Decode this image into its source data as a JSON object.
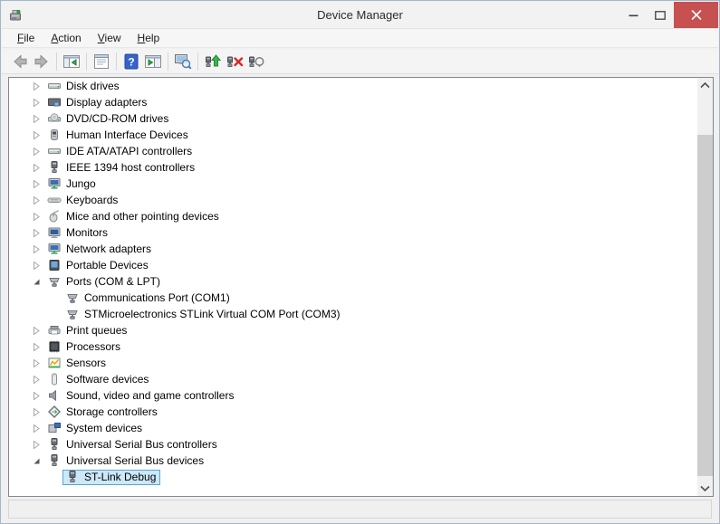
{
  "window": {
    "title": "Device Manager",
    "icon": "device-manager-icon",
    "controls": [
      {
        "name": "minimize-button",
        "icon": "minimize-icon"
      },
      {
        "name": "maximize-button",
        "icon": "maximize-icon"
      },
      {
        "name": "close-button",
        "icon": "close-icon"
      }
    ]
  },
  "menu": {
    "items": [
      {
        "first": "F",
        "rest": "ile"
      },
      {
        "first": "A",
        "rest": "ction"
      },
      {
        "first": "V",
        "rest": "iew"
      },
      {
        "first": "H",
        "rest": "elp"
      }
    ]
  },
  "toolbar": {
    "help_glyph": "?",
    "buttons": [
      "back",
      "forward",
      "show-hide-console-tree",
      "properties",
      "help",
      "show-hide-action-pane",
      "scan-computer",
      "update-driver",
      "uninstall-device",
      "scan-for-hardware-changes"
    ]
  },
  "tree": {
    "items": [
      {
        "label": "Disk drives",
        "icon": "disk",
        "level": 0,
        "state": "collapsed",
        "selected": false
      },
      {
        "label": "Display adapters",
        "icon": "display",
        "level": 0,
        "state": "collapsed",
        "selected": false
      },
      {
        "label": "DVD/CD-ROM drives",
        "icon": "dvd",
        "level": 0,
        "state": "collapsed",
        "selected": false
      },
      {
        "label": "Human Interface Devices",
        "icon": "hid",
        "level": 0,
        "state": "collapsed",
        "selected": false
      },
      {
        "label": "IDE ATA/ATAPI controllers",
        "icon": "disk",
        "level": 0,
        "state": "collapsed",
        "selected": false
      },
      {
        "label": "IEEE 1394 host controllers",
        "icon": "usb",
        "level": 0,
        "state": "collapsed",
        "selected": false
      },
      {
        "label": "Jungo",
        "icon": "netpc",
        "level": 0,
        "state": "collapsed",
        "selected": false
      },
      {
        "label": "Keyboards",
        "icon": "keyboard",
        "level": 0,
        "state": "collapsed",
        "selected": false
      },
      {
        "label": "Mice and other pointing devices",
        "icon": "mouse",
        "level": 0,
        "state": "collapsed",
        "selected": false
      },
      {
        "label": "Monitors",
        "icon": "monitor",
        "level": 0,
        "state": "collapsed",
        "selected": false
      },
      {
        "label": "Network adapters",
        "icon": "netpc",
        "level": 0,
        "state": "collapsed",
        "selected": false
      },
      {
        "label": "Portable Devices",
        "icon": "portable",
        "level": 0,
        "state": "collapsed",
        "selected": false
      },
      {
        "label": "Ports (COM & LPT)",
        "icon": "port",
        "level": 0,
        "state": "expanded",
        "selected": false
      },
      {
        "label": "Communications Port (COM1)",
        "icon": "port",
        "level": 1,
        "state": "leaf",
        "selected": false
      },
      {
        "label": "STMicroelectronics STLink Virtual COM Port (COM3)",
        "icon": "port",
        "level": 1,
        "state": "leaf",
        "selected": false
      },
      {
        "label": "Print queues",
        "icon": "printer",
        "level": 0,
        "state": "collapsed",
        "selected": false
      },
      {
        "label": "Processors",
        "icon": "cpu",
        "level": 0,
        "state": "collapsed",
        "selected": false
      },
      {
        "label": "Sensors",
        "icon": "sensor",
        "level": 0,
        "state": "collapsed",
        "selected": false
      },
      {
        "label": "Software devices",
        "icon": "software",
        "level": 0,
        "state": "collapsed",
        "selected": false
      },
      {
        "label": "Sound, video and game controllers",
        "icon": "speaker",
        "level": 0,
        "state": "collapsed",
        "selected": false
      },
      {
        "label": "Storage controllers",
        "icon": "storage",
        "level": 0,
        "state": "collapsed",
        "selected": false
      },
      {
        "label": "System devices",
        "icon": "system",
        "level": 0,
        "state": "collapsed",
        "selected": false
      },
      {
        "label": "Universal Serial Bus controllers",
        "icon": "usb",
        "level": 0,
        "state": "collapsed",
        "selected": false
      },
      {
        "label": "Universal Serial Bus devices",
        "icon": "usb",
        "level": 0,
        "state": "expanded",
        "selected": false
      },
      {
        "label": "ST-Link Debug",
        "icon": "usb",
        "level": 1,
        "state": "leaf",
        "selected": true
      }
    ]
  },
  "status": {
    "text": ""
  },
  "colors": {
    "close_button": "#c75050",
    "selection_bg": "#cde8f6",
    "selection_border": "#51a7dc",
    "window_border": "#a6b6ca",
    "scrollbar_thumb": "#cdcdcd"
  }
}
